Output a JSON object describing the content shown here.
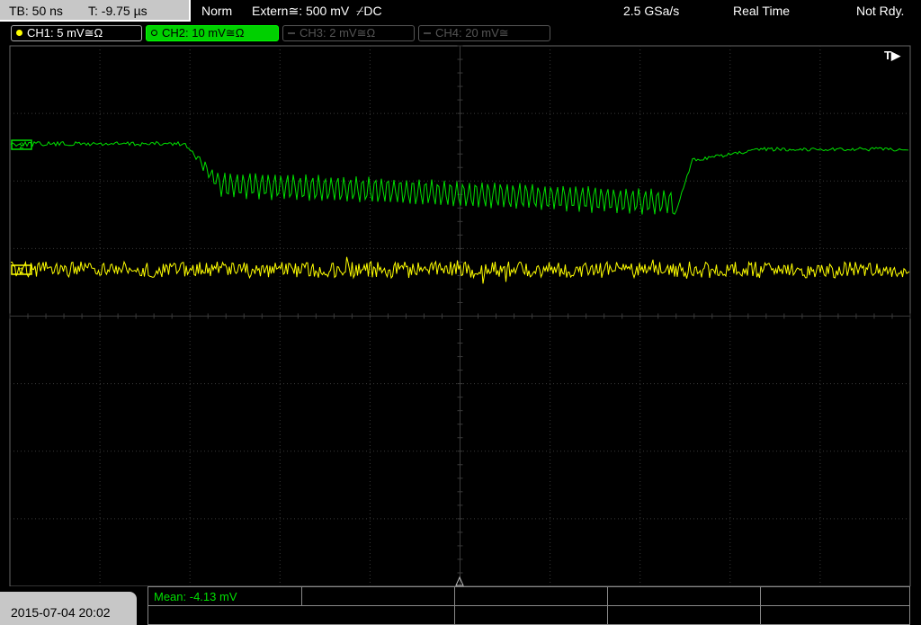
{
  "header": {
    "timebase": "TB: 50 ns",
    "trigger_time": "T: -9.75 µs",
    "trigger_mode": "Norm",
    "trigger_source": "Extern≅: 500 mV",
    "trigger_slope": "⌿DC",
    "sample_rate": "2.5 GSa/s",
    "acq_mode": "Real Time",
    "status": "Not Rdy."
  },
  "channels": [
    {
      "label": "CH1: 5 mV≅Ω",
      "color": "#ffff00",
      "active": true
    },
    {
      "label": "CH2: 10 mV≅Ω",
      "color": "#00e000",
      "active": true,
      "selected": true
    },
    {
      "label": "CH3: 2 mV≅Ω",
      "color": "#555555",
      "active": false
    },
    {
      "label": "CH4: 20 mV≅",
      "color": "#555555",
      "active": false
    }
  ],
  "screen": {
    "trigger_marker": "T▶",
    "ch1_marker": "1",
    "ch2_marker": "2",
    "grid_color": "#3a3a3a",
    "ch1_color": "#ffff00",
    "ch2_color": "#00e000"
  },
  "footer": {
    "datetime": "2015-07-04 20:02",
    "measurement": "Mean: -4.13 mV"
  }
}
